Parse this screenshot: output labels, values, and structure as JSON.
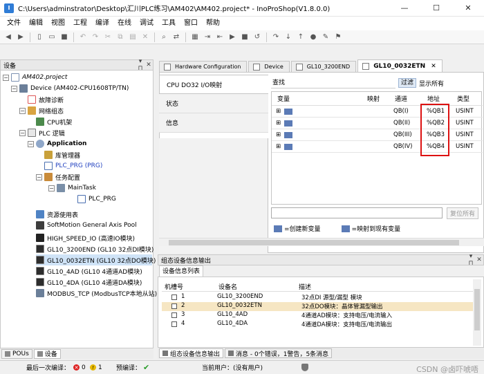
{
  "window": {
    "title": "C:\\Users\\adminstrator\\Desktop\\汇川PLC练习\\AM402\\AM402.project* - InoProShop(V1.8.0.0)",
    "minimize": "—",
    "maximize": "☐",
    "close": "✕"
  },
  "menu": [
    "文件",
    "编辑",
    "视图",
    "工程",
    "编译",
    "在线",
    "调试",
    "工具",
    "窗口",
    "帮助"
  ],
  "left_panel": {
    "title": "设备",
    "pin": "▾ ⊓",
    "close": "✕",
    "tree": [
      {
        "label": "AM402.project",
        "style": "italic"
      },
      {
        "label": "Device (AM402-CPU1608TP/TN)"
      },
      {
        "label": "故障诊断"
      },
      {
        "label": "网络组态"
      },
      {
        "label": "CPU机架"
      },
      {
        "label": "PLC 逻辑"
      },
      {
        "label": "Application"
      },
      {
        "label": "库管理器"
      },
      {
        "label": "PLC_PRG (PRG)"
      },
      {
        "label": "任务配置"
      },
      {
        "label": "MainTask"
      },
      {
        "label": "PLC_PRG"
      },
      {
        "label": "资源使用表"
      },
      {
        "label": "SoftMotion General Axis Pool"
      },
      {
        "label": "HIGH_SPEED_IO (高速IO模块)"
      },
      {
        "label": "GL10_3200END (GL10 32点DI模块)"
      },
      {
        "label": "GL10_0032ETN (GL10 32点DO模块)"
      },
      {
        "label": "GL10_4AD (GL10 4通道AD模块)"
      },
      {
        "label": "GL10_4DA (GL10 4通道DA模块)"
      },
      {
        "label": "MODBUS_TCP (ModbusTCP本地从站)"
      }
    ],
    "bottom_tabs": [
      "POUs",
      "设备"
    ]
  },
  "editor": {
    "tabs": [
      "Hardware Configuration",
      "Device",
      "GL10_3200END",
      "GL10_0032ETN"
    ],
    "side_tabs": [
      "CPU DO32 I/O映射",
      "状态",
      "信息"
    ],
    "find_label": "查找",
    "filter_label": "过滤",
    "show_all": "显示所有",
    "columns": [
      "变量",
      "映射",
      "通道",
      "地址",
      "类型"
    ],
    "rows": [
      {
        "channel": "QB(I)",
        "address": "%QB1",
        "type": "USINT"
      },
      {
        "channel": "QB(II)",
        "address": "%QB2",
        "type": "USINT"
      },
      {
        "channel": "QB(III)",
        "address": "%QB3",
        "type": "USINT"
      },
      {
        "channel": "QB(IV)",
        "address": "%QB4",
        "type": "USINT"
      }
    ],
    "restore_button": "复位所有",
    "legend_new": "=创建新变量",
    "legend_map": "=映射到现有变量"
  },
  "bottom_panel": {
    "title": "组态设备信息输出",
    "subtab": "设备信息列表",
    "columns": [
      "机槽号",
      "设备名",
      "描述"
    ],
    "rows": [
      {
        "slot": "1",
        "name": "GL10_3200END",
        "desc": "32点DI 源型/漏型 模块"
      },
      {
        "slot": "2",
        "name": "GL10_0032ETN",
        "desc": "32点DO模块：晶体管漏型输出"
      },
      {
        "slot": "3",
        "name": "GL10_4AD",
        "desc": "4通道AD模块：支持电压/电流输入"
      },
      {
        "slot": "4",
        "name": "GL10_4DA",
        "desc": "4通道DA模块：支持电压/电流输出"
      }
    ],
    "output_tabs": [
      "组态设备信息输出",
      "消息 - 0个错误，1警告，5条消息"
    ]
  },
  "status": {
    "last_compile_label": "最后一次编译：",
    "errors": "0",
    "warnings": "1",
    "precompile_label": "预编译：",
    "user_label": "当前用户：(没有用户)",
    "watermark": "CSDN @卤吓唬唔"
  }
}
